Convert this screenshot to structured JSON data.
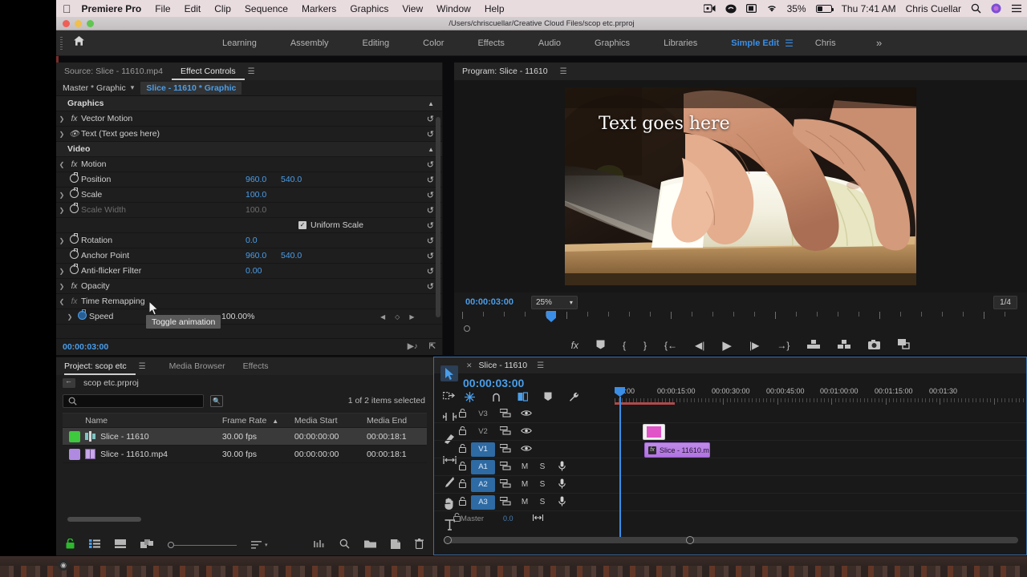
{
  "menubar": {
    "apple": "apple-logo",
    "app": "Premiere Pro",
    "items": [
      "File",
      "Edit",
      "Clip",
      "Sequence",
      "Markers",
      "Graphics",
      "View",
      "Window",
      "Help"
    ],
    "status": {
      "battery_percent": "35%",
      "clock": "Thu 7:41 AM",
      "user": "Chris Cuellar"
    }
  },
  "window": {
    "title_path": "/Users/chriscuellar/Creative Cloud Files/scop etc.prproj"
  },
  "workspaces": {
    "tabs": [
      "Learning",
      "Assembly",
      "Editing",
      "Color",
      "Effects",
      "Audio",
      "Graphics",
      "Libraries",
      "Simple Edit",
      "Chris"
    ],
    "active": "Simple Edit",
    "overflow": "»"
  },
  "effect_controls": {
    "tabs": [
      {
        "label": "Source: Slice - 11610.mp4",
        "active": false
      },
      {
        "label": "Effect Controls",
        "active": true
      }
    ],
    "clip_bar": {
      "master": "Master * Graphic",
      "selected": "Slice - 11610 * Graphic"
    },
    "groups": [
      {
        "name": "Graphics",
        "rows": [
          {
            "label": "Vector Motion",
            "type": "effect",
            "twirl": ">",
            "icon": "fx"
          },
          {
            "label": "Text (Text goes here)",
            "type": "effect",
            "twirl": ">",
            "icon": "eye"
          }
        ]
      },
      {
        "name": "Video",
        "rows": [
          {
            "label": "Motion",
            "type": "effect",
            "twirl": "v",
            "icon": "fx"
          },
          {
            "label": "Position",
            "type": "prop",
            "v1": "960.0",
            "v2": "540.0"
          },
          {
            "label": "Scale",
            "type": "prop",
            "twirl": ">",
            "v1": "100.0"
          },
          {
            "label": "Scale Width",
            "type": "prop",
            "twirl": ">",
            "v1": "100.0",
            "dim": true
          },
          {
            "label": "Uniform Scale",
            "type": "checkbox",
            "checked": true
          },
          {
            "label": "Rotation",
            "type": "prop",
            "twirl": ">",
            "v1": "0.0"
          },
          {
            "label": "Anchor Point",
            "type": "prop",
            "v1": "960.0",
            "v2": "540.0"
          },
          {
            "label": "Anti-flicker Filter",
            "type": "prop",
            "twirl": ">",
            "v1": "0.00"
          },
          {
            "label": "Opacity",
            "type": "effect",
            "twirl": ">",
            "icon": "fx"
          },
          {
            "label": "Time Remapping",
            "type": "effect",
            "twirl": "v",
            "icon": "fx"
          },
          {
            "label": "Speed",
            "type": "prop",
            "twirl": ">",
            "v1": "100.00%",
            "keyframed": true
          }
        ]
      }
    ],
    "tooltip": "Toggle animation",
    "footer_timecode": "00:00:03:00"
  },
  "program_monitor": {
    "tab": "Program: Slice - 11610",
    "overlay_text": "Text goes here",
    "timecode": "00:00:03:00",
    "zoom_level": "25%",
    "resolution": "1/4",
    "transport_icons": [
      "fx",
      "marker",
      "mark-in",
      "mark-out",
      "go-to-in",
      "step-back",
      "play",
      "step-forward",
      "go-to-out",
      "lift",
      "extract",
      "export-frame",
      "button-editor"
    ]
  },
  "project_panel": {
    "tabs": [
      {
        "label": "Project: scop etc",
        "active": true
      },
      {
        "label": "Media Browser",
        "active": false
      },
      {
        "label": "Effects",
        "active": false
      }
    ],
    "breadcrumb": "scop etc.prproj",
    "search_placeholder": "",
    "selection_status": "1 of 2 items selected",
    "columns": [
      "Name",
      "Frame Rate",
      "Media Start",
      "Media End"
    ],
    "sort_column": "Frame Rate",
    "rows": [
      {
        "name": "Slice - 11610",
        "frame_rate": "30.00 fps",
        "media_start": "00:00:00:00",
        "media_end": "00:00:18:1",
        "color": "#3ec93e",
        "kind": "sequence",
        "selected": true
      },
      {
        "name": "Slice - 11610.mp4",
        "frame_rate": "30.00 fps",
        "media_start": "00:00:00:00",
        "media_end": "00:00:18:1",
        "color": "#b08ae0",
        "kind": "clip",
        "selected": false
      }
    ],
    "footer_icons": [
      "lock",
      "list-view",
      "icon-view",
      "freeform-view",
      "zoom-slider",
      "sort-icon",
      "automate-to-sequence",
      "find",
      "new-bin",
      "new-item",
      "delete"
    ]
  },
  "timeline": {
    "tab": "Slice - 11610",
    "timecode": "00:00:03:00",
    "tools": [
      "selection-tool",
      "track-select-forward-tool",
      "ripple-edit-tool",
      "razor-tool",
      "slip-tool",
      "pen-tool",
      "hand-tool",
      "type-tool"
    ],
    "active_tool": "selection-tool",
    "header_icons": [
      "snap-in-timeline",
      "linked-selection",
      "add-marker",
      "timeline-display-settings",
      "wrench"
    ],
    "ruler_labels": [
      ":00:00",
      "00:00:15:00",
      "00:00:30:00",
      "00:00:45:00",
      "00:01:00:00",
      "00:01:15:00",
      "00:01:30"
    ],
    "tracks": [
      {
        "name": "V3",
        "type": "video",
        "targeted": false
      },
      {
        "name": "V2",
        "type": "video",
        "targeted": false
      },
      {
        "name": "V1",
        "type": "video",
        "targeted": true
      },
      {
        "name": "A1",
        "type": "audio",
        "targeted": true,
        "mute": "M",
        "solo": "S"
      },
      {
        "name": "A2",
        "type": "audio",
        "targeted": true,
        "mute": "M",
        "solo": "S"
      },
      {
        "name": "A3",
        "type": "audio",
        "targeted": true,
        "mute": "M",
        "solo": "S"
      }
    ],
    "master_label": "Master",
    "master_value": "0.0",
    "clips": [
      {
        "track": "V2",
        "label": "",
        "kind": "graphic"
      },
      {
        "track": "V1",
        "label": "Slice - 11610.m",
        "kind": "video"
      }
    ]
  }
}
